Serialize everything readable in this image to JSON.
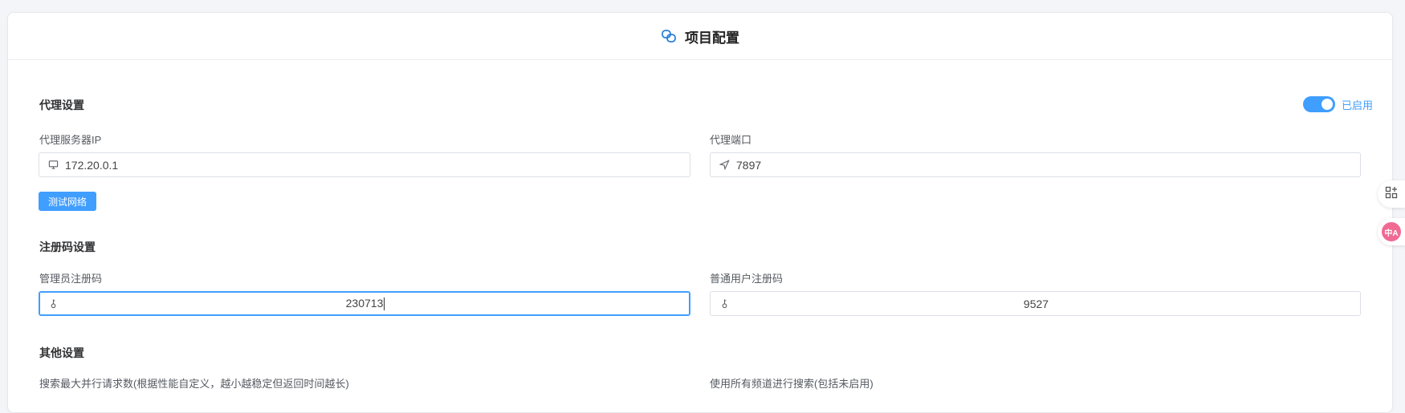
{
  "header": {
    "title": "项目配置",
    "icon": "link-icon"
  },
  "proxy": {
    "section_title": "代理设置",
    "toggle_label": "已启用",
    "toggle_on": true,
    "server_ip_label": "代理服务器IP",
    "server_ip_value": "172.20.0.1",
    "port_label": "代理端口",
    "port_value": "7897",
    "test_button": "测试网络"
  },
  "registration": {
    "section_title": "注册码设置",
    "admin_label": "管理员注册码",
    "admin_value": "230713",
    "user_label": "普通用户注册码",
    "user_value": "9527"
  },
  "other": {
    "section_title": "其他设置",
    "max_requests_label": "搜索最大并行请求数(根据性能自定义，越小越稳定但返回时间越长)",
    "all_channels_label": "使用所有频道进行搜索(包括未启用)"
  },
  "side_tools": [
    {
      "icon": "apps-add-icon"
    },
    {
      "icon": "translate-icon",
      "text": "中A"
    }
  ],
  "colors": {
    "accent": "#409eff",
    "translate_badge": "#f06a93"
  }
}
